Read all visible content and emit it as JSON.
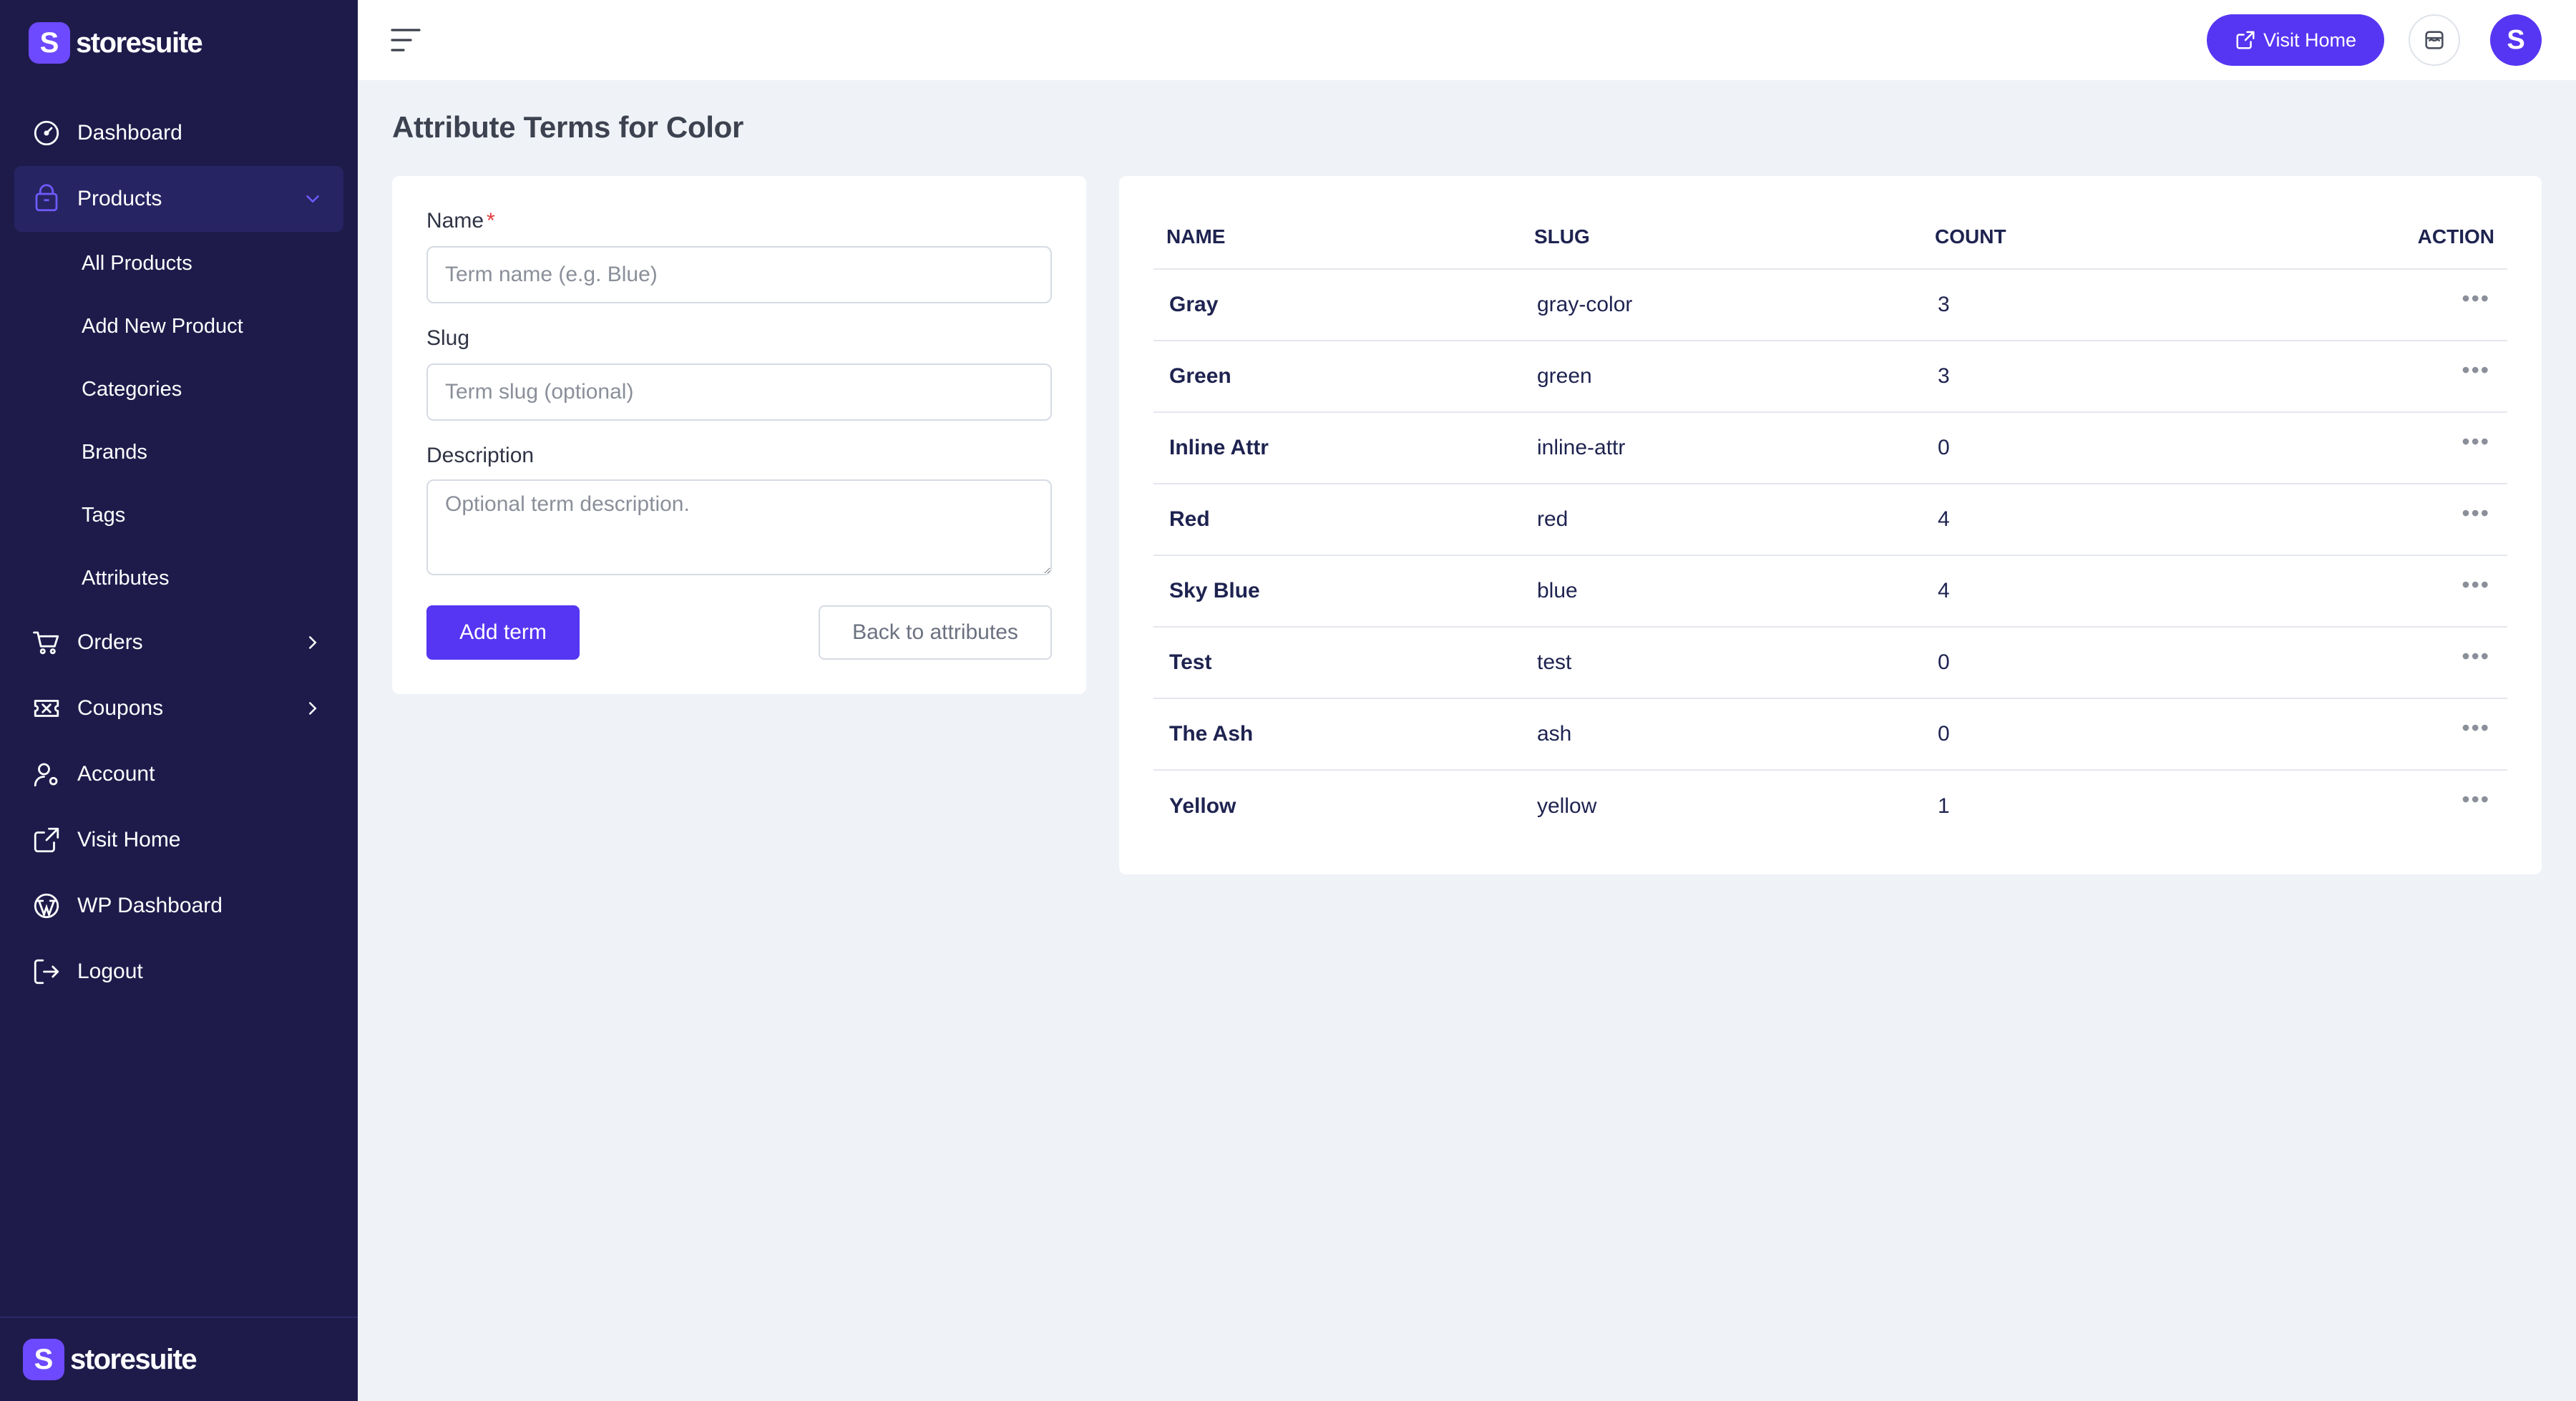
{
  "brand": {
    "name": "storesuite",
    "mark": "S"
  },
  "sidebar": {
    "items": [
      {
        "label": "Dashboard",
        "icon": "dashboard-gauge-icon"
      },
      {
        "label": "Products",
        "icon": "box-icon",
        "expanded": true,
        "children": [
          "All Products",
          "Add New Product",
          "Categories",
          "Brands",
          "Tags",
          "Attributes"
        ]
      },
      {
        "label": "Orders",
        "icon": "cart-icon"
      },
      {
        "label": "Coupons",
        "icon": "coupon-icon"
      },
      {
        "label": "Account",
        "icon": "user-gear-icon"
      },
      {
        "label": "Visit Home",
        "icon": "external-link-icon"
      },
      {
        "label": "WP Dashboard",
        "icon": "wordpress-icon"
      },
      {
        "label": "Logout",
        "icon": "logout-icon"
      }
    ]
  },
  "topbar": {
    "visit_home_label": "Visit Home",
    "avatar_letter": "S"
  },
  "page": {
    "title": "Attribute Terms for Color"
  },
  "form": {
    "name_label": "Name",
    "required_mark": "*",
    "name_placeholder": "Term name (e.g. Blue)",
    "slug_label": "Slug",
    "slug_placeholder": "Term slug (optional)",
    "description_label": "Description",
    "description_placeholder": "Optional term description.",
    "add_button": "Add term",
    "back_button": "Back to attributes"
  },
  "table": {
    "headers": {
      "name": "NAME",
      "slug": "SLUG",
      "count": "COUNT",
      "action": "ACTION"
    },
    "rows": [
      {
        "name": "Gray",
        "slug": "gray-color",
        "count": "3"
      },
      {
        "name": "Green",
        "slug": "green",
        "count": "3"
      },
      {
        "name": "Inline Attr",
        "slug": "inline-attr",
        "count": "0"
      },
      {
        "name": "Red",
        "slug": "red",
        "count": "4"
      },
      {
        "name": "Sky Blue",
        "slug": "blue",
        "count": "4"
      },
      {
        "name": "Test",
        "slug": "test",
        "count": "0"
      },
      {
        "name": "The Ash",
        "slug": "ash",
        "count": "0"
      },
      {
        "name": "Yellow",
        "slug": "yellow",
        "count": "1"
      }
    ],
    "action_glyph": "•••"
  },
  "colors": {
    "sidebar_bg": "#1e1b4b",
    "sidebar_active": "#272463",
    "accent": "#5636f2",
    "brand_mark": "#6d4aff",
    "page_bg": "#eff3f7"
  }
}
